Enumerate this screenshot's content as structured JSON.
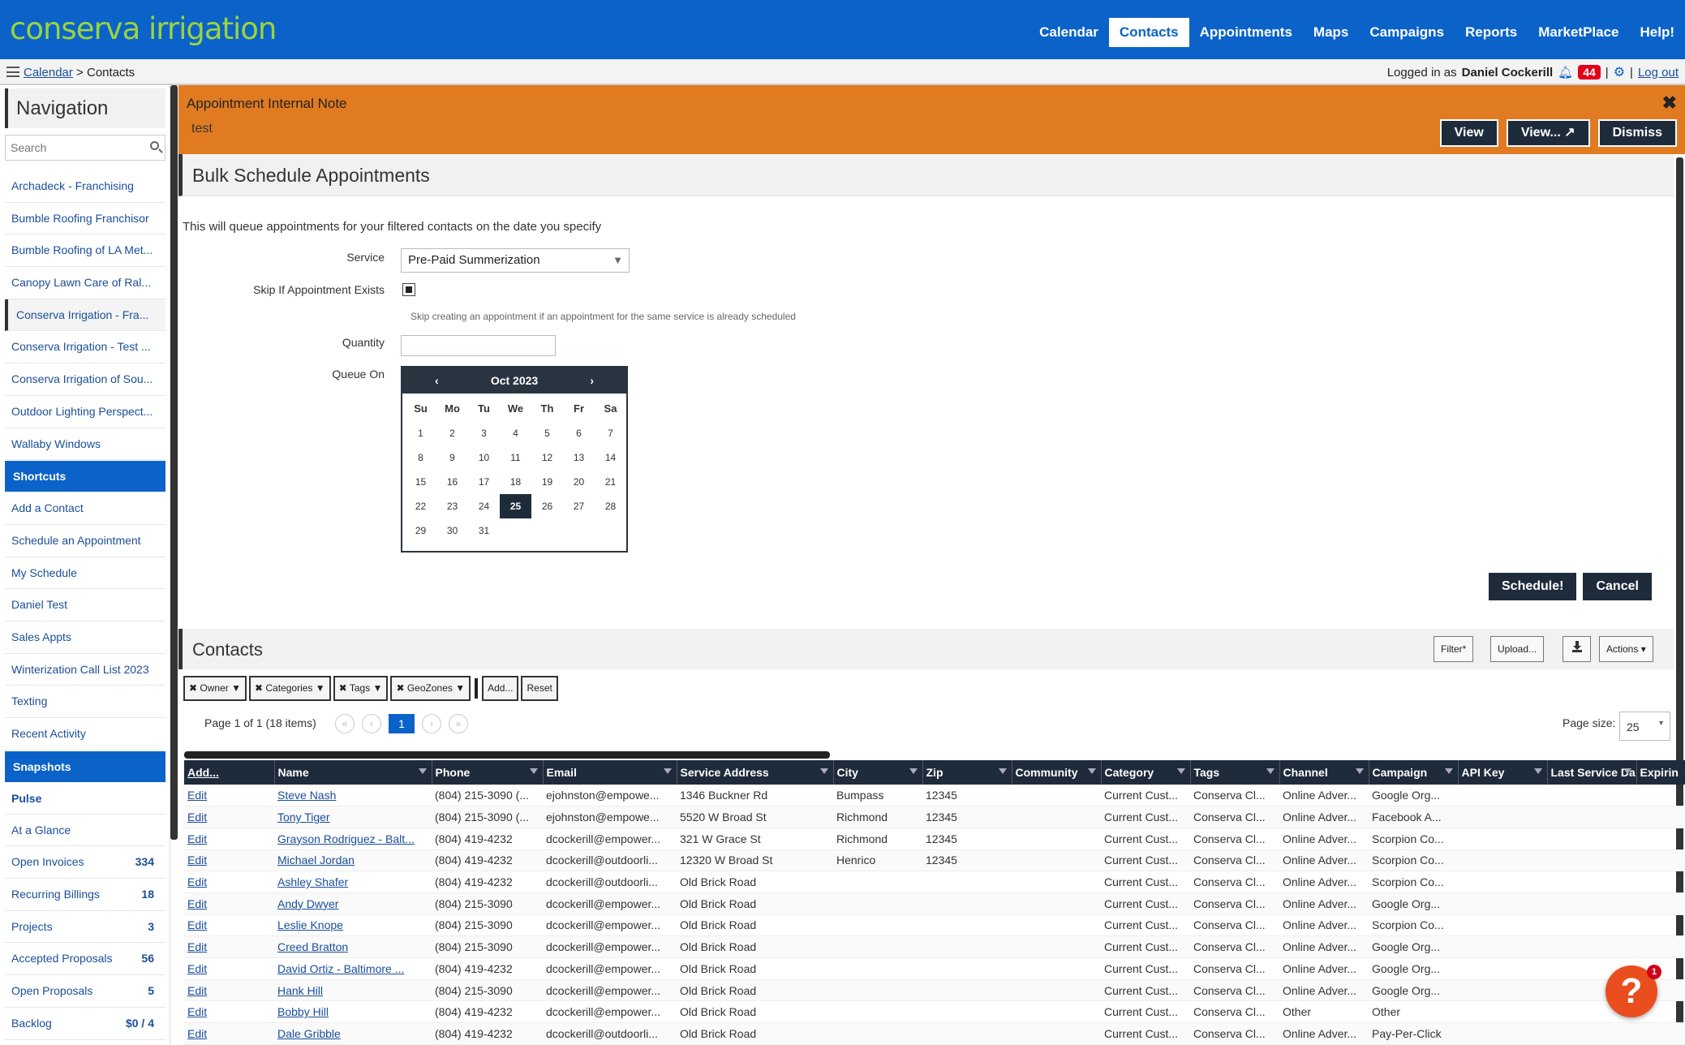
{
  "app": {
    "logo": "conserva irrigation"
  },
  "topnav": [
    "Calendar",
    "Contacts",
    "Appointments",
    "Maps",
    "Campaigns",
    "Reports",
    "MarketPlace",
    "Help!"
  ],
  "breadcrumb": {
    "link": "Calendar",
    "sep": ">",
    "current": "Contacts"
  },
  "user": {
    "prefix": "Logged in as",
    "name": "Daniel Cockerill",
    "notifications": "44",
    "logout": "Log out"
  },
  "sidebar": {
    "title": "Navigation",
    "search_placeholder": "Search",
    "orgs": [
      "Archadeck - Franchising",
      "Bumble Roofing Franchisor",
      "Bumble Roofing of LA Met...",
      "Canopy Lawn Care of Ral...",
      "Conserva Irrigation - Fra...",
      "Conserva Irrigation - Test ...",
      "Conserva Irrigation of Sou...",
      "Outdoor Lighting Perspect...",
      "Wallaby Windows"
    ],
    "shortcuts_head": "Shortcuts",
    "shortcuts": [
      "Add a Contact",
      "Schedule an Appointment",
      "My Schedule",
      "Daniel Test",
      "Sales Appts",
      "Winterization Call List 2023",
      "Texting",
      "Recent Activity"
    ],
    "snapshots_head": "Snapshots",
    "pulse": "Pulse",
    "snapshots": [
      {
        "label": "At a Glance",
        "count": ""
      },
      {
        "label": "Open Invoices",
        "count": "334"
      },
      {
        "label": "Recurring Billings",
        "count": "18"
      },
      {
        "label": "Projects",
        "count": "3"
      },
      {
        "label": "Accepted Proposals",
        "count": "56"
      },
      {
        "label": "Open Proposals",
        "count": "5"
      },
      {
        "label": "Backlog",
        "count": "$0 / 4"
      }
    ]
  },
  "alert": {
    "title": "Appointment Internal Note",
    "body": "test",
    "view": "View",
    "view_new": "View...",
    "dismiss": "Dismiss"
  },
  "bulk": {
    "title": "Bulk Schedule Appointments",
    "intro": "This will queue appointments for your filtered contacts on the date you specify",
    "service_label": "Service",
    "service_value": "Pre-Paid Summerization",
    "skip_label": "Skip If Appointment Exists",
    "skip_hint": "Skip creating an appointment if an appointment for the same service is already scheduled",
    "quantity_label": "Quantity",
    "queue_label": "Queue On",
    "calendar": {
      "month": "Oct 2023",
      "dow": [
        "Su",
        "Mo",
        "Tu",
        "We",
        "Th",
        "Fr",
        "Sa"
      ],
      "weeks": [
        [
          "1",
          "2",
          "3",
          "4",
          "5",
          "6",
          "7"
        ],
        [
          "8",
          "9",
          "10",
          "11",
          "12",
          "13",
          "14"
        ],
        [
          "15",
          "16",
          "17",
          "18",
          "19",
          "20",
          "21"
        ],
        [
          "22",
          "23",
          "24",
          "25",
          "26",
          "27",
          "28"
        ],
        [
          "29",
          "30",
          "31",
          "",
          "",
          "",
          ""
        ]
      ],
      "selected": "25"
    },
    "schedule": "Schedule!",
    "cancel": "Cancel"
  },
  "contacts": {
    "title": "Contacts",
    "filter": "Filter*",
    "upload": "Upload...",
    "actions": "Actions",
    "filters": [
      "Owner",
      "Categories",
      "Tags",
      "GeoZones"
    ],
    "add": "Add...",
    "reset": "Reset",
    "page_info": "Page 1 of 1 (18 items)",
    "page_current": "1",
    "page_size_label": "Page size:",
    "page_size": "25",
    "columns": [
      "Add...",
      "Name",
      "Phone",
      "Email",
      "Service Address",
      "City",
      "Zip",
      "Community",
      "Category",
      "Tags",
      "Channel",
      "Campaign",
      "API Key",
      "Last Service Da",
      "Expirin"
    ],
    "rows": [
      [
        "Edit",
        "Steve Nash",
        "(804) 215-3090 (...",
        "ejohnston@empowe...",
        "1346 Buckner Rd",
        "Bumpass",
        "12345",
        "",
        "Current Cust...",
        "Conserva Cl...",
        "Online Adver...",
        "Google Org...",
        "",
        "",
        ""
      ],
      [
        "Edit",
        "Tony Tiger",
        "(804) 215-3090 (...",
        "ejohnston@empowe...",
        "5520 W Broad St",
        "Richmond",
        "12345",
        "",
        "Current Cust...",
        "Conserva Cl...",
        "Online Adver...",
        "Facebook A...",
        "",
        "",
        ""
      ],
      [
        "Edit",
        "Grayson Rodriguez - Balt...",
        "(804) 419-4232",
        "dcockerill@empower...",
        "321 W Grace St",
        "Richmond",
        "12345",
        "",
        "Current Cust...",
        "Conserva Cl...",
        "Online Adver...",
        "Scorpion Co...",
        "",
        "",
        ""
      ],
      [
        "Edit",
        "Michael Jordan",
        "(804) 419-4232",
        "dcockerill@outdoorli...",
        "12320 W Broad St",
        "Henrico",
        "12345",
        "",
        "Current Cust...",
        "Conserva Cl...",
        "Online Adver...",
        "Scorpion Co...",
        "",
        "",
        ""
      ],
      [
        "Edit",
        "Ashley Shafer",
        "(804) 419-4232",
        "dcockerill@outdoorli...",
        "Old Brick Road",
        "",
        "",
        "",
        "Current Cust...",
        "Conserva Cl...",
        "Online Adver...",
        "Scorpion Co...",
        "",
        "",
        ""
      ],
      [
        "Edit",
        "Andy Dwyer",
        "(804) 215-3090",
        "dcockerill@empower...",
        "Old Brick Road",
        "",
        "",
        "",
        "Current Cust...",
        "Conserva Cl...",
        "Online Adver...",
        "Google Org...",
        "",
        "",
        ""
      ],
      [
        "Edit",
        "Leslie Knope",
        "(804) 215-3090",
        "dcockerill@empower...",
        "Old Brick Road",
        "",
        "",
        "",
        "Current Cust...",
        "Conserva Cl...",
        "Online Adver...",
        "Scorpion Co...",
        "",
        "",
        ""
      ],
      [
        "Edit",
        "Creed Bratton",
        "(804) 215-3090",
        "dcockerill@empower...",
        "Old Brick Road",
        "",
        "",
        "",
        "Current Cust...",
        "Conserva Cl...",
        "Online Adver...",
        "Google Org...",
        "",
        "",
        ""
      ],
      [
        "Edit",
        "David Ortiz - Baltimore ...",
        "(804) 419-4232",
        "dcockerill@empower...",
        "Old Brick Road",
        "",
        "",
        "",
        "Current Cust...",
        "Conserva Cl...",
        "Online Adver...",
        "Google Org...",
        "",
        "",
        ""
      ],
      [
        "Edit",
        "Hank Hill",
        "(804) 215-3090",
        "dcockerill@empower...",
        "Old Brick Road",
        "",
        "",
        "",
        "Current Cust...",
        "Conserva Cl...",
        "Online Adver...",
        "Google Org...",
        "",
        "",
        ""
      ],
      [
        "Edit",
        "Bobby Hill",
        "(804) 419-4232",
        "dcockerill@empower...",
        "Old Brick Road",
        "",
        "",
        "",
        "Current Cust...",
        "Conserva Cl...",
        "Other",
        "Other",
        "",
        "",
        ""
      ],
      [
        "Edit",
        "Dale Gribble",
        "(804) 419-4232",
        "dcockerill@outdoorli...",
        "Old Brick Road",
        "",
        "",
        "",
        "Current Cust...",
        "Conserva Cl...",
        "Online Adver...",
        "Pay-Per-Click",
        "",
        "",
        ""
      ]
    ]
  },
  "help_badge": "1"
}
